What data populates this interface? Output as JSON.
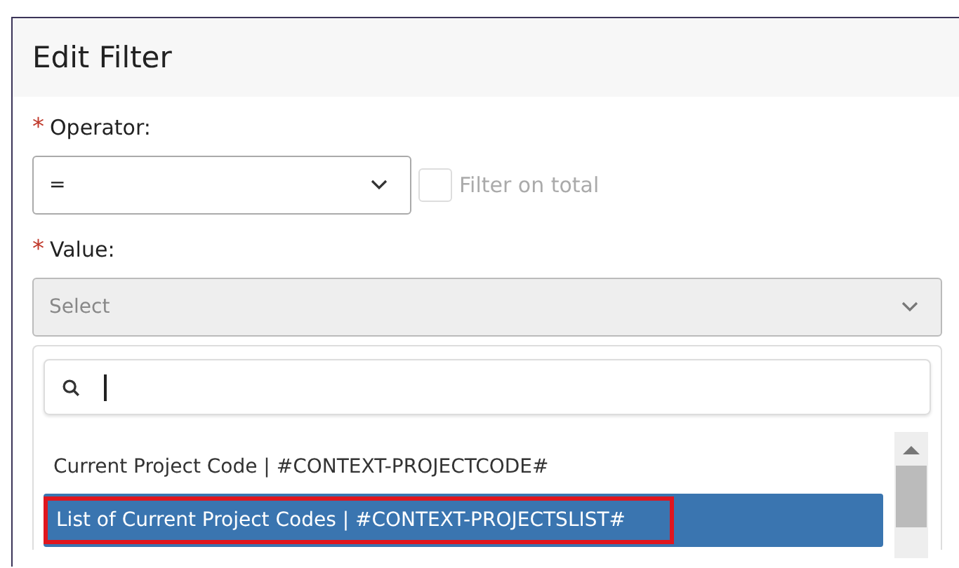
{
  "dialog": {
    "title": "Edit Filter"
  },
  "operator": {
    "label": "Operator:",
    "required_mark": "*",
    "value": "=",
    "filter_on_total": {
      "label": "Filter on total",
      "checked": false
    }
  },
  "value": {
    "label": "Value:",
    "required_mark": "*",
    "placeholder": "Select",
    "expanded": true
  },
  "dropdown": {
    "options": [
      {
        "label": "Current Project Code | #CONTEXT-PROJECTCODE#",
        "selected": false,
        "highlighted": false
      },
      {
        "label": "List of Current Project Codes | #CONTEXT-PROJECTSLIST#",
        "selected": true,
        "highlighted": true
      }
    ]
  }
}
